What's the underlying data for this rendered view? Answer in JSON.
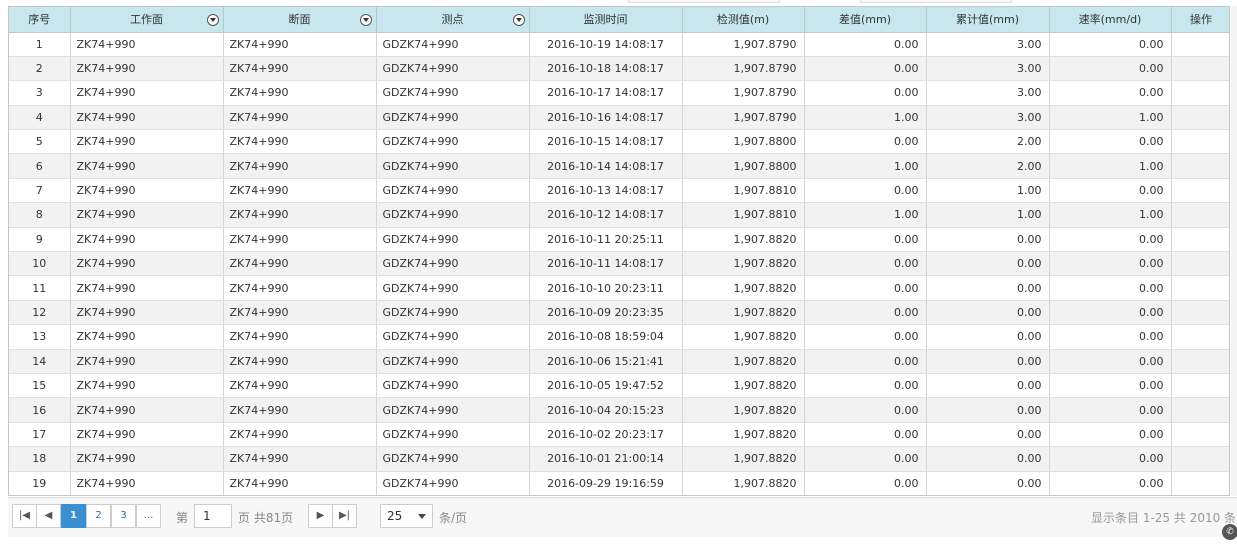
{
  "columns": [
    {
      "label": "序号",
      "filter": false
    },
    {
      "label": "工作面",
      "filter": true
    },
    {
      "label": "断面",
      "filter": true
    },
    {
      "label": "测点",
      "filter": true
    },
    {
      "label": "监测时间",
      "filter": false
    },
    {
      "label": "检测值(m)",
      "filter": false
    },
    {
      "label": "差值(mm)",
      "filter": false
    },
    {
      "label": "累计值(mm)",
      "filter": false
    },
    {
      "label": "速率(mm/d)",
      "filter": false
    },
    {
      "label": "操作",
      "filter": false
    }
  ],
  "rows": [
    [
      "1",
      "ZK74+990",
      "ZK74+990",
      "GDZK74+990",
      "2016-10-19 14:08:17",
      "1,907.8790",
      "0.00",
      "3.00",
      "0.00",
      ""
    ],
    [
      "2",
      "ZK74+990",
      "ZK74+990",
      "GDZK74+990",
      "2016-10-18 14:08:17",
      "1,907.8790",
      "0.00",
      "3.00",
      "0.00",
      ""
    ],
    [
      "3",
      "ZK74+990",
      "ZK74+990",
      "GDZK74+990",
      "2016-10-17 14:08:17",
      "1,907.8790",
      "0.00",
      "3.00",
      "0.00",
      ""
    ],
    [
      "4",
      "ZK74+990",
      "ZK74+990",
      "GDZK74+990",
      "2016-10-16 14:08:17",
      "1,907.8790",
      "1.00",
      "3.00",
      "1.00",
      ""
    ],
    [
      "5",
      "ZK74+990",
      "ZK74+990",
      "GDZK74+990",
      "2016-10-15 14:08:17",
      "1,907.8800",
      "0.00",
      "2.00",
      "0.00",
      ""
    ],
    [
      "6",
      "ZK74+990",
      "ZK74+990",
      "GDZK74+990",
      "2016-10-14 14:08:17",
      "1,907.8800",
      "1.00",
      "2.00",
      "1.00",
      ""
    ],
    [
      "7",
      "ZK74+990",
      "ZK74+990",
      "GDZK74+990",
      "2016-10-13 14:08:17",
      "1,907.8810",
      "0.00",
      "1.00",
      "0.00",
      ""
    ],
    [
      "8",
      "ZK74+990",
      "ZK74+990",
      "GDZK74+990",
      "2016-10-12 14:08:17",
      "1,907.8810",
      "1.00",
      "1.00",
      "1.00",
      ""
    ],
    [
      "9",
      "ZK74+990",
      "ZK74+990",
      "GDZK74+990",
      "2016-10-11 20:25:11",
      "1,907.8820",
      "0.00",
      "0.00",
      "0.00",
      ""
    ],
    [
      "10",
      "ZK74+990",
      "ZK74+990",
      "GDZK74+990",
      "2016-10-11 14:08:17",
      "1,907.8820",
      "0.00",
      "0.00",
      "0.00",
      ""
    ],
    [
      "11",
      "ZK74+990",
      "ZK74+990",
      "GDZK74+990",
      "2016-10-10 20:23:11",
      "1,907.8820",
      "0.00",
      "0.00",
      "0.00",
      ""
    ],
    [
      "12",
      "ZK74+990",
      "ZK74+990",
      "GDZK74+990",
      "2016-10-09 20:23:35",
      "1,907.8820",
      "0.00",
      "0.00",
      "0.00",
      ""
    ],
    [
      "13",
      "ZK74+990",
      "ZK74+990",
      "GDZK74+990",
      "2016-10-08 18:59:04",
      "1,907.8820",
      "0.00",
      "0.00",
      "0.00",
      ""
    ],
    [
      "14",
      "ZK74+990",
      "ZK74+990",
      "GDZK74+990",
      "2016-10-06 15:21:41",
      "1,907.8820",
      "0.00",
      "0.00",
      "0.00",
      ""
    ],
    [
      "15",
      "ZK74+990",
      "ZK74+990",
      "GDZK74+990",
      "2016-10-05 19:47:52",
      "1,907.8820",
      "0.00",
      "0.00",
      "0.00",
      ""
    ],
    [
      "16",
      "ZK74+990",
      "ZK74+990",
      "GDZK74+990",
      "2016-10-04 20:15:23",
      "1,907.8820",
      "0.00",
      "0.00",
      "0.00",
      ""
    ],
    [
      "17",
      "ZK74+990",
      "ZK74+990",
      "GDZK74+990",
      "2016-10-02 20:23:17",
      "1,907.8820",
      "0.00",
      "0.00",
      "0.00",
      ""
    ],
    [
      "18",
      "ZK74+990",
      "ZK74+990",
      "GDZK74+990",
      "2016-10-01 21:00:14",
      "1,907.8820",
      "0.00",
      "0.00",
      "0.00",
      ""
    ],
    [
      "19",
      "ZK74+990",
      "ZK74+990",
      "GDZK74+990",
      "2016-09-29 19:16:59",
      "1,907.8820",
      "0.00",
      "0.00",
      "0.00",
      ""
    ]
  ],
  "pager": {
    "first_icon": "first-page-icon",
    "prev_icon": "prev-page-icon",
    "next_icon": "next-page-icon",
    "last_icon": "last-page-icon",
    "pages": [
      "1",
      "2",
      "3",
      "..."
    ],
    "active_page": "1",
    "page_prefix": "第",
    "page_input_value": "1",
    "page_suffix": "页 共81页",
    "page_size": "25",
    "page_size_suffix": "条/页",
    "summary": "显示条目 1-25 共 2010 条"
  },
  "colors": {
    "header_bg": "#c7e6ee",
    "active_page": "#3a8fd3",
    "row_alt": "#f2f2f2"
  }
}
